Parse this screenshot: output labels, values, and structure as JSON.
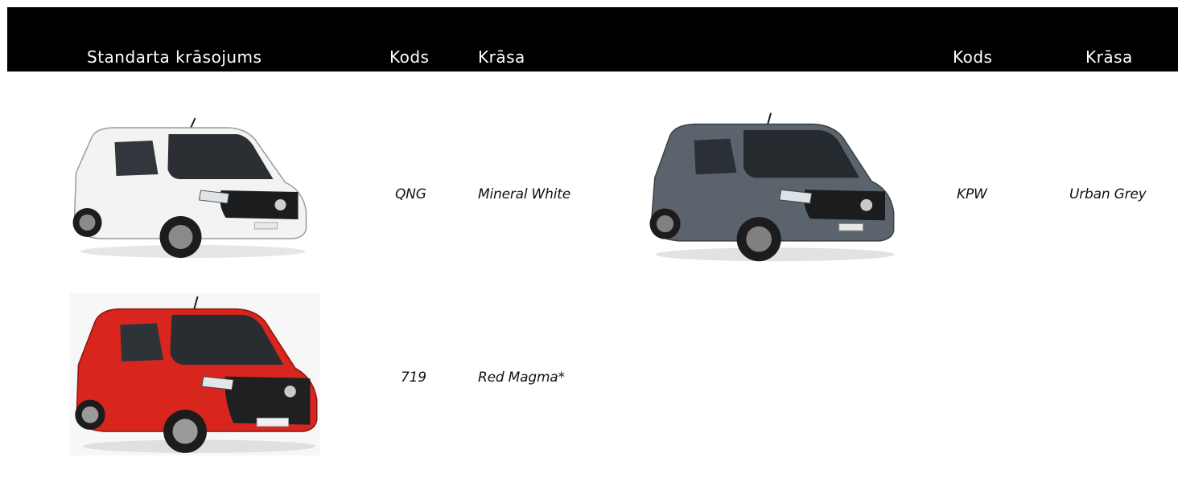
{
  "header": {
    "title": "Standarta krāsojums",
    "code_label_left": "Kods",
    "color_label_left": "Krāsa",
    "code_label_right": "Kods",
    "color_label_right": "Krāsa"
  },
  "colors": [
    {
      "code": "QNG",
      "name": "Mineral White",
      "paint": "#f3f3f3"
    },
    {
      "code": "KPW",
      "name": "Urban Grey",
      "paint": "#5b646d"
    },
    {
      "code": "719",
      "name": "Red Magma*",
      "paint": "#d8261f"
    }
  ],
  "theme": {
    "header_bg": "#000000",
    "header_text": "#ffffff"
  }
}
